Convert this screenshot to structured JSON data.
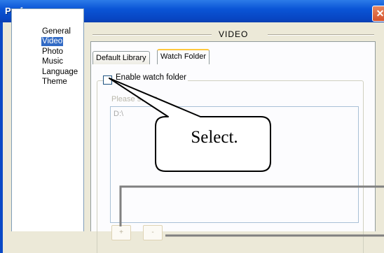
{
  "window": {
    "title": "Preferences",
    "close_icon": "close-icon",
    "close_glyph": "✕"
  },
  "sidebar": {
    "items": [
      {
        "label": "General",
        "selected": false
      },
      {
        "label": "Video",
        "selected": true
      },
      {
        "label": "Photo",
        "selected": false
      },
      {
        "label": "Music",
        "selected": false
      },
      {
        "label": "Language",
        "selected": false
      },
      {
        "label": "Theme",
        "selected": false
      }
    ]
  },
  "main": {
    "section_title": "VIDEO",
    "tabs": [
      {
        "label": "Default Library",
        "active": false
      },
      {
        "label": "Watch Folder",
        "active": true
      }
    ],
    "watch_folder": {
      "enable_label": "Enable watch folder",
      "enabled": false,
      "hint": "Please select",
      "folders": [
        "D:\\"
      ],
      "add_label": "+",
      "remove_label": "-"
    }
  },
  "annotation": {
    "callout_text": "Select."
  },
  "colors": {
    "title_bar": "#0a55d6",
    "selection": "#316ac5",
    "dialog_bg": "#ece9d8"
  }
}
